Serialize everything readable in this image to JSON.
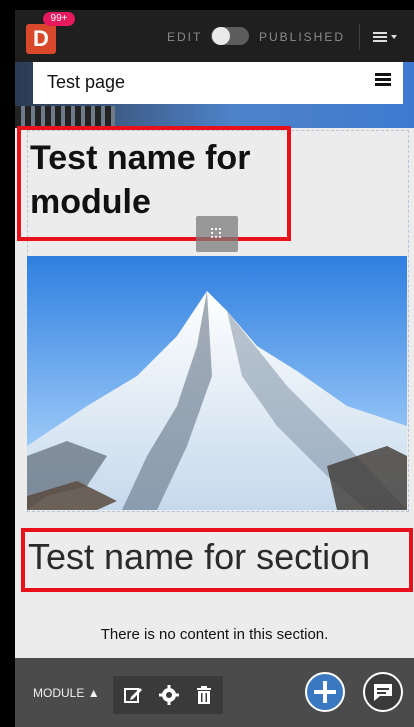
{
  "app": {
    "logo_letter": "D",
    "notification_count": "99+",
    "edit_label": "EDIT",
    "published_label": "PUBLISHED",
    "menu_icon": "hamburger-caret-icon"
  },
  "page": {
    "title": "Test page"
  },
  "module": {
    "title": "Test name for module",
    "expand_icon": "fullscreen-icon"
  },
  "section": {
    "title": "Test name for section",
    "empty_message": "There is no content in this section."
  },
  "toolbar": {
    "module_label": "MODULE",
    "tools": [
      "edit-icon",
      "gear-icon",
      "trash-icon"
    ],
    "add_icon": "plus-icon",
    "chat_icon": "chat-icon"
  },
  "colors": {
    "logo": "#d9482b",
    "badge": "#e6195c",
    "highlight": "#e8101a",
    "add_button": "#3a78c2"
  }
}
